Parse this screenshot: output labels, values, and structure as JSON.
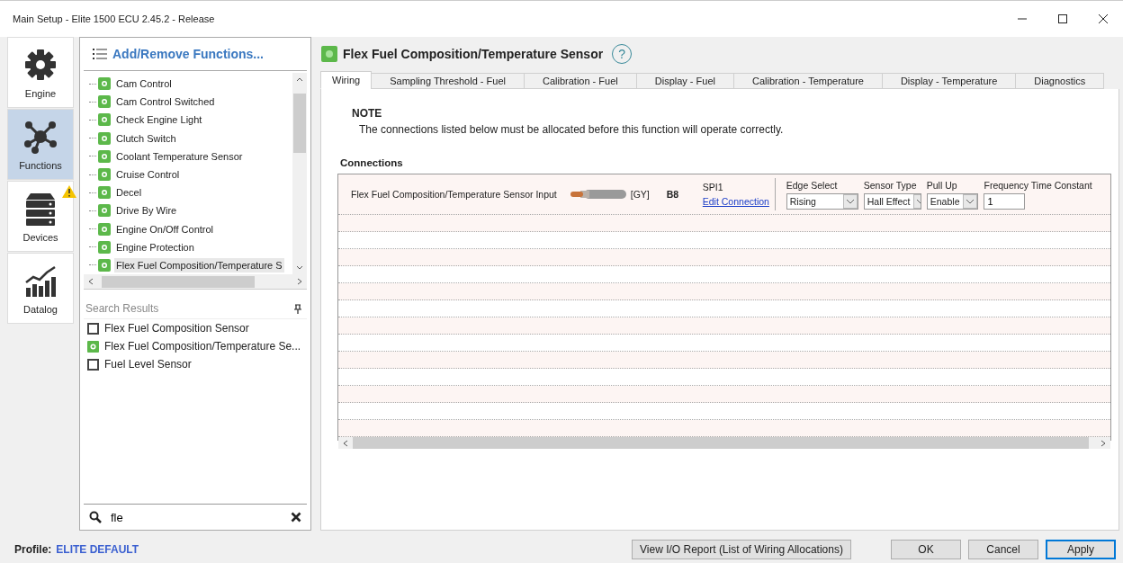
{
  "window": {
    "title": "Main Setup - Elite 1500 ECU 2.45.2 - Release"
  },
  "nav": [
    {
      "label": "Engine",
      "selected": false,
      "warning": false
    },
    {
      "label": "Functions",
      "selected": true,
      "warning": false
    },
    {
      "label": "Devices",
      "selected": false,
      "warning": true
    },
    {
      "label": "Datalog",
      "selected": false,
      "warning": false
    }
  ],
  "functions": {
    "header": "Add/Remove Functions...",
    "items": [
      {
        "label": "Cam Control",
        "selected": false
      },
      {
        "label": "Cam Control Switched",
        "selected": false
      },
      {
        "label": "Check Engine Light",
        "selected": false
      },
      {
        "label": "Clutch Switch",
        "selected": false
      },
      {
        "label": "Coolant Temperature Sensor",
        "selected": false
      },
      {
        "label": "Cruise Control",
        "selected": false
      },
      {
        "label": "Decel",
        "selected": false
      },
      {
        "label": "Drive By Wire",
        "selected": false
      },
      {
        "label": "Engine On/Off Control",
        "selected": false
      },
      {
        "label": "Engine Protection",
        "selected": false
      },
      {
        "label": "Flex Fuel Composition/Temperature S",
        "selected": true
      }
    ],
    "results_header": "Search Results",
    "results": [
      {
        "label": "Flex Fuel Composition Sensor",
        "kind": "unused"
      },
      {
        "label": "Flex Fuel  Composition/Temperature  Se...",
        "kind": "active"
      },
      {
        "label": "Fuel Level Sensor",
        "kind": "unused"
      }
    ],
    "search": {
      "value": "fle"
    }
  },
  "profile": {
    "label": "Profile:",
    "value": "ELITE DEFAULT"
  },
  "main": {
    "title": "Flex Fuel Composition/Temperature Sensor",
    "help": "?",
    "tabs": [
      {
        "label": "Wiring",
        "selected": true
      },
      {
        "label": "Sampling Threshold - Fuel",
        "selected": false
      },
      {
        "label": "Calibration - Fuel",
        "selected": false
      },
      {
        "label": "Display - Fuel",
        "selected": false
      },
      {
        "label": "Calibration - Temperature",
        "selected": false
      },
      {
        "label": "Display - Temperature",
        "selected": false
      },
      {
        "label": "Diagnostics",
        "selected": false
      }
    ],
    "note_title": "NOTE",
    "note_text": "The connections listed below must be allocated before this function will operate correctly.",
    "connections_label": "Connections",
    "connection": {
      "name": "Flex Fuel Composition/Temperature Sensor Input",
      "wire": "[GY]",
      "pin": "B8",
      "channel": "SPI1",
      "link": "Edit Connection",
      "settings": [
        {
          "label": "Edge Select",
          "value": "Rising",
          "kind": "select"
        },
        {
          "label": "Sensor Type",
          "value": "Hall Effect",
          "kind": "select"
        },
        {
          "label": "Pull Up",
          "value": "Enable",
          "kind": "select"
        },
        {
          "label": "Frequency Time Constant",
          "value": "1",
          "kind": "input"
        }
      ]
    }
  },
  "buttons": [
    {
      "label": "View I/O Report (List of Wiring Allocations)",
      "default": false
    },
    {
      "label": "OK",
      "default": false
    },
    {
      "label": "Cancel",
      "default": false
    },
    {
      "label": "Apply",
      "default": true
    }
  ]
}
